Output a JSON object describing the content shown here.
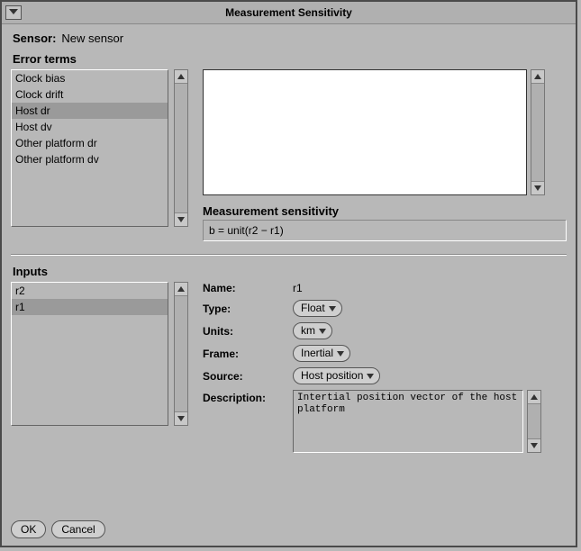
{
  "window": {
    "title": "Measurement Sensitivity"
  },
  "sensor": {
    "label": "Sensor:",
    "value": "New sensor"
  },
  "error_terms": {
    "title": "Error terms",
    "items": [
      "Clock bias",
      "Clock drift",
      "Host dr",
      "Host dv",
      "Other platform dr",
      "Other platform dv"
    ],
    "selected_index": 2
  },
  "measurement": {
    "title": "Measurement sensitivity",
    "formula": "b =  unit(r2 − r1)"
  },
  "inputs": {
    "title": "Inputs",
    "items": [
      "r2",
      "r1"
    ],
    "selected_index": 1
  },
  "form": {
    "name": {
      "label": "Name:",
      "value": "r1"
    },
    "type": {
      "label": "Type:",
      "value": "Float"
    },
    "units": {
      "label": "Units:",
      "value": "km"
    },
    "frame": {
      "label": "Frame:",
      "value": "Inertial"
    },
    "source": {
      "label": "Source:",
      "value": "Host position"
    },
    "description": {
      "label": "Description:",
      "value": "Intertial position vector of the host platform"
    }
  },
  "buttons": {
    "ok": "OK",
    "cancel": "Cancel"
  }
}
